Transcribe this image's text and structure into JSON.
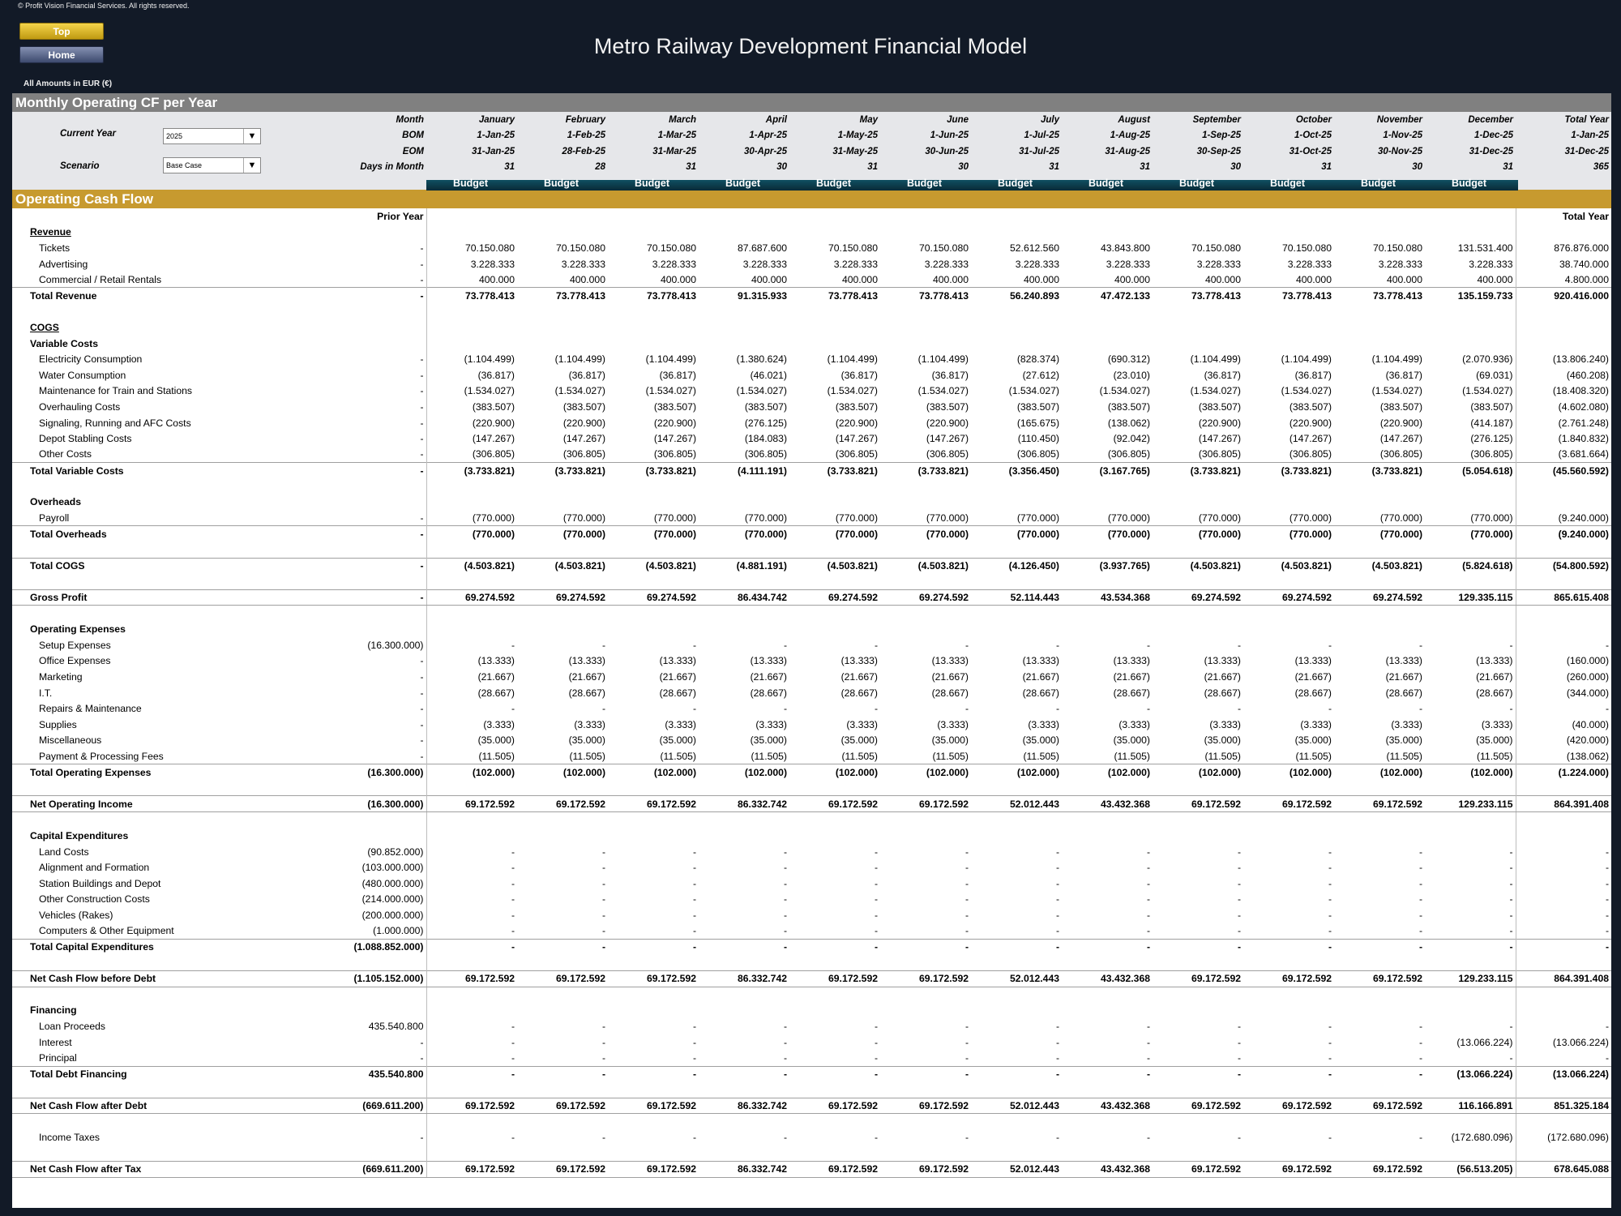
{
  "header": {
    "copyright": "© Profit Vision Financial Services. All rights reserved.",
    "top_button": "Top",
    "home_button": "Home",
    "title": "Metro Railway Development Financial Model",
    "amounts_note": "All Amounts in  EUR (€)"
  },
  "section_title": "Monthly Operating CF per Year",
  "controls": {
    "current_year_label": "Current Year",
    "current_year_value": "2025",
    "scenario_label": "Scenario",
    "scenario_value": "Base Case"
  },
  "row_labels": {
    "month": "Month",
    "bom": "BOM",
    "eom": "EOM",
    "days": "Days in Month"
  },
  "months": [
    "January",
    "February",
    "March",
    "April",
    "May",
    "June",
    "July",
    "August",
    "September",
    "October",
    "November",
    "December",
    "Total Year"
  ],
  "bom": [
    "1-Jan-25",
    "1-Feb-25",
    "1-Mar-25",
    "1-Apr-25",
    "1-May-25",
    "1-Jun-25",
    "1-Jul-25",
    "1-Aug-25",
    "1-Sep-25",
    "1-Oct-25",
    "1-Nov-25",
    "1-Dec-25",
    "1-Jan-25"
  ],
  "eom": [
    "31-Jan-25",
    "28-Feb-25",
    "31-Mar-25",
    "30-Apr-25",
    "31-May-25",
    "30-Jun-25",
    "31-Jul-25",
    "31-Aug-25",
    "30-Sep-25",
    "31-Oct-25",
    "30-Nov-25",
    "31-Dec-25",
    "31-Dec-25"
  ],
  "days": [
    "31",
    "28",
    "31",
    "30",
    "31",
    "30",
    "31",
    "31",
    "30",
    "31",
    "30",
    "31",
    "365"
  ],
  "budget_label": "Budget",
  "ocf_title": "Operating Cash Flow",
  "prior_year_header": "Prior Year",
  "total_year_header": "Total Year",
  "rows": [
    {
      "label": "Revenue",
      "style": "head-u",
      "py": "",
      "v": []
    },
    {
      "label": "Tickets",
      "style": "sub",
      "py": "-",
      "v": [
        "70.150.080",
        "70.150.080",
        "70.150.080",
        "87.687.600",
        "70.150.080",
        "70.150.080",
        "52.612.560",
        "43.843.800",
        "70.150.080",
        "70.150.080",
        "70.150.080",
        "131.531.400",
        "876.876.000"
      ]
    },
    {
      "label": "Advertising",
      "style": "sub",
      "py": "-",
      "v": [
        "3.228.333",
        "3.228.333",
        "3.228.333",
        "3.228.333",
        "3.228.333",
        "3.228.333",
        "3.228.333",
        "3.228.333",
        "3.228.333",
        "3.228.333",
        "3.228.333",
        "3.228.333",
        "38.740.000"
      ]
    },
    {
      "label": "Commercial / Retail Rentals",
      "style": "sub",
      "py": "-",
      "v": [
        "400.000",
        "400.000",
        "400.000",
        "400.000",
        "400.000",
        "400.000",
        "400.000",
        "400.000",
        "400.000",
        "400.000",
        "400.000",
        "400.000",
        "4.800.000"
      ]
    },
    {
      "label": "Total Revenue",
      "style": "total",
      "py": "-",
      "v": [
        "73.778.413",
        "73.778.413",
        "73.778.413",
        "91.315.933",
        "73.778.413",
        "73.778.413",
        "56.240.893",
        "47.472.133",
        "73.778.413",
        "73.778.413",
        "73.778.413",
        "135.159.733",
        "920.416.000"
      ]
    },
    {
      "label": "",
      "style": "blank",
      "py": "",
      "v": []
    },
    {
      "label": "COGS",
      "style": "head-u",
      "py": "",
      "v": []
    },
    {
      "label": "Variable Costs",
      "style": "head",
      "py": "",
      "v": []
    },
    {
      "label": "Electricity Consumption",
      "style": "sub",
      "py": "-",
      "v": [
        "(1.104.499)",
        "(1.104.499)",
        "(1.104.499)",
        "(1.380.624)",
        "(1.104.499)",
        "(1.104.499)",
        "(828.374)",
        "(690.312)",
        "(1.104.499)",
        "(1.104.499)",
        "(1.104.499)",
        "(2.070.936)",
        "(13.806.240)"
      ]
    },
    {
      "label": "Water Consumption",
      "style": "sub",
      "py": "-",
      "v": [
        "(36.817)",
        "(36.817)",
        "(36.817)",
        "(46.021)",
        "(36.817)",
        "(36.817)",
        "(27.612)",
        "(23.010)",
        "(36.817)",
        "(36.817)",
        "(36.817)",
        "(69.031)",
        "(460.208)"
      ]
    },
    {
      "label": "Maintenance for Train and Stations",
      "style": "sub",
      "py": "-",
      "v": [
        "(1.534.027)",
        "(1.534.027)",
        "(1.534.027)",
        "(1.534.027)",
        "(1.534.027)",
        "(1.534.027)",
        "(1.534.027)",
        "(1.534.027)",
        "(1.534.027)",
        "(1.534.027)",
        "(1.534.027)",
        "(1.534.027)",
        "(18.408.320)"
      ]
    },
    {
      "label": "Overhauling Costs",
      "style": "sub",
      "py": "-",
      "v": [
        "(383.507)",
        "(383.507)",
        "(383.507)",
        "(383.507)",
        "(383.507)",
        "(383.507)",
        "(383.507)",
        "(383.507)",
        "(383.507)",
        "(383.507)",
        "(383.507)",
        "(383.507)",
        "(4.602.080)"
      ]
    },
    {
      "label": "Signaling, Running and AFC Costs",
      "style": "sub",
      "py": "-",
      "v": [
        "(220.900)",
        "(220.900)",
        "(220.900)",
        "(276.125)",
        "(220.900)",
        "(220.900)",
        "(165.675)",
        "(138.062)",
        "(220.900)",
        "(220.900)",
        "(220.900)",
        "(414.187)",
        "(2.761.248)"
      ]
    },
    {
      "label": "Depot Stabling Costs",
      "style": "sub",
      "py": "-",
      "v": [
        "(147.267)",
        "(147.267)",
        "(147.267)",
        "(184.083)",
        "(147.267)",
        "(147.267)",
        "(110.450)",
        "(92.042)",
        "(147.267)",
        "(147.267)",
        "(147.267)",
        "(276.125)",
        "(1.840.832)"
      ]
    },
    {
      "label": "Other Costs",
      "style": "sub",
      "py": "-",
      "v": [
        "(306.805)",
        "(306.805)",
        "(306.805)",
        "(306.805)",
        "(306.805)",
        "(306.805)",
        "(306.805)",
        "(306.805)",
        "(306.805)",
        "(306.805)",
        "(306.805)",
        "(306.805)",
        "(3.681.664)"
      ]
    },
    {
      "label": "Total Variable Costs",
      "style": "total",
      "py": "-",
      "v": [
        "(3.733.821)",
        "(3.733.821)",
        "(3.733.821)",
        "(4.111.191)",
        "(3.733.821)",
        "(3.733.821)",
        "(3.356.450)",
        "(3.167.765)",
        "(3.733.821)",
        "(3.733.821)",
        "(3.733.821)",
        "(5.054.618)",
        "(45.560.592)"
      ]
    },
    {
      "label": "",
      "style": "blank",
      "py": "",
      "v": []
    },
    {
      "label": "Overheads",
      "style": "head",
      "py": "",
      "v": []
    },
    {
      "label": "Payroll",
      "style": "sub",
      "py": "-",
      "v": [
        "(770.000)",
        "(770.000)",
        "(770.000)",
        "(770.000)",
        "(770.000)",
        "(770.000)",
        "(770.000)",
        "(770.000)",
        "(770.000)",
        "(770.000)",
        "(770.000)",
        "(770.000)",
        "(9.240.000)"
      ]
    },
    {
      "label": "Total Overheads",
      "style": "total",
      "py": "-",
      "v": [
        "(770.000)",
        "(770.000)",
        "(770.000)",
        "(770.000)",
        "(770.000)",
        "(770.000)",
        "(770.000)",
        "(770.000)",
        "(770.000)",
        "(770.000)",
        "(770.000)",
        "(770.000)",
        "(9.240.000)"
      ]
    },
    {
      "label": "",
      "style": "blank",
      "py": "",
      "v": []
    },
    {
      "label": "Total COGS",
      "style": "total",
      "py": "-",
      "v": [
        "(4.503.821)",
        "(4.503.821)",
        "(4.503.821)",
        "(4.881.191)",
        "(4.503.821)",
        "(4.503.821)",
        "(4.126.450)",
        "(3.937.765)",
        "(4.503.821)",
        "(4.503.821)",
        "(4.503.821)",
        "(5.824.618)",
        "(54.800.592)"
      ]
    },
    {
      "label": "",
      "style": "blank",
      "py": "",
      "v": []
    },
    {
      "label": "Gross Profit",
      "style": "grand",
      "py": "-",
      "v": [
        "69.274.592",
        "69.274.592",
        "69.274.592",
        "86.434.742",
        "69.274.592",
        "69.274.592",
        "52.114.443",
        "43.534.368",
        "69.274.592",
        "69.274.592",
        "69.274.592",
        "129.335.115",
        "865.615.408"
      ]
    },
    {
      "label": "",
      "style": "blank",
      "py": "",
      "v": []
    },
    {
      "label": "Operating Expenses",
      "style": "head",
      "py": "",
      "v": []
    },
    {
      "label": "Setup Expenses",
      "style": "sub",
      "py": "(16.300.000)",
      "v": [
        "-",
        "-",
        "-",
        "-",
        "-",
        "-",
        "-",
        "-",
        "-",
        "-",
        "-",
        "-",
        "-"
      ]
    },
    {
      "label": "Office Expenses",
      "style": "sub",
      "py": "-",
      "v": [
        "(13.333)",
        "(13.333)",
        "(13.333)",
        "(13.333)",
        "(13.333)",
        "(13.333)",
        "(13.333)",
        "(13.333)",
        "(13.333)",
        "(13.333)",
        "(13.333)",
        "(13.333)",
        "(160.000)"
      ]
    },
    {
      "label": "Marketing",
      "style": "sub",
      "py": "-",
      "v": [
        "(21.667)",
        "(21.667)",
        "(21.667)",
        "(21.667)",
        "(21.667)",
        "(21.667)",
        "(21.667)",
        "(21.667)",
        "(21.667)",
        "(21.667)",
        "(21.667)",
        "(21.667)",
        "(260.000)"
      ]
    },
    {
      "label": "I.T.",
      "style": "sub",
      "py": "-",
      "v": [
        "(28.667)",
        "(28.667)",
        "(28.667)",
        "(28.667)",
        "(28.667)",
        "(28.667)",
        "(28.667)",
        "(28.667)",
        "(28.667)",
        "(28.667)",
        "(28.667)",
        "(28.667)",
        "(344.000)"
      ]
    },
    {
      "label": "Repairs & Maintenance",
      "style": "sub",
      "py": "-",
      "v": [
        "-",
        "-",
        "-",
        "-",
        "-",
        "-",
        "-",
        "-",
        "-",
        "-",
        "-",
        "-",
        "-"
      ]
    },
    {
      "label": "Supplies",
      "style": "sub",
      "py": "-",
      "v": [
        "(3.333)",
        "(3.333)",
        "(3.333)",
        "(3.333)",
        "(3.333)",
        "(3.333)",
        "(3.333)",
        "(3.333)",
        "(3.333)",
        "(3.333)",
        "(3.333)",
        "(3.333)",
        "(40.000)"
      ]
    },
    {
      "label": "Miscellaneous",
      "style": "sub",
      "py": "-",
      "v": [
        "(35.000)",
        "(35.000)",
        "(35.000)",
        "(35.000)",
        "(35.000)",
        "(35.000)",
        "(35.000)",
        "(35.000)",
        "(35.000)",
        "(35.000)",
        "(35.000)",
        "(35.000)",
        "(420.000)"
      ]
    },
    {
      "label": "Payment & Processing Fees",
      "style": "sub",
      "py": "-",
      "v": [
        "(11.505)",
        "(11.505)",
        "(11.505)",
        "(11.505)",
        "(11.505)",
        "(11.505)",
        "(11.505)",
        "(11.505)",
        "(11.505)",
        "(11.505)",
        "(11.505)",
        "(11.505)",
        "(138.062)"
      ]
    },
    {
      "label": "Total Operating Expenses",
      "style": "total",
      "py": "(16.300.000)",
      "v": [
        "(102.000)",
        "(102.000)",
        "(102.000)",
        "(102.000)",
        "(102.000)",
        "(102.000)",
        "(102.000)",
        "(102.000)",
        "(102.000)",
        "(102.000)",
        "(102.000)",
        "(102.000)",
        "(1.224.000)"
      ]
    },
    {
      "label": "",
      "style": "blank",
      "py": "",
      "v": []
    },
    {
      "label": "Net Operating Income",
      "style": "grand",
      "py": "(16.300.000)",
      "v": [
        "69.172.592",
        "69.172.592",
        "69.172.592",
        "86.332.742",
        "69.172.592",
        "69.172.592",
        "52.012.443",
        "43.432.368",
        "69.172.592",
        "69.172.592",
        "69.172.592",
        "129.233.115",
        "864.391.408"
      ]
    },
    {
      "label": "",
      "style": "blank",
      "py": "",
      "v": []
    },
    {
      "label": "Capital Expenditures",
      "style": "head",
      "py": "",
      "v": []
    },
    {
      "label": "Land Costs",
      "style": "sub",
      "py": "(90.852.000)",
      "v": [
        "-",
        "-",
        "-",
        "-",
        "-",
        "-",
        "-",
        "-",
        "-",
        "-",
        "-",
        "-",
        "-"
      ]
    },
    {
      "label": "Alignment and Formation",
      "style": "sub",
      "py": "(103.000.000)",
      "v": [
        "-",
        "-",
        "-",
        "-",
        "-",
        "-",
        "-",
        "-",
        "-",
        "-",
        "-",
        "-",
        "-"
      ]
    },
    {
      "label": "Station Buildings and Depot",
      "style": "sub",
      "py": "(480.000.000)",
      "v": [
        "-",
        "-",
        "-",
        "-",
        "-",
        "-",
        "-",
        "-",
        "-",
        "-",
        "-",
        "-",
        "-"
      ]
    },
    {
      "label": "Other Construction Costs",
      "style": "sub",
      "py": "(214.000.000)",
      "v": [
        "-",
        "-",
        "-",
        "-",
        "-",
        "-",
        "-",
        "-",
        "-",
        "-",
        "-",
        "-",
        "-"
      ]
    },
    {
      "label": "Vehicles (Rakes)",
      "style": "sub",
      "py": "(200.000.000)",
      "v": [
        "-",
        "-",
        "-",
        "-",
        "-",
        "-",
        "-",
        "-",
        "-",
        "-",
        "-",
        "-",
        "-"
      ]
    },
    {
      "label": "Computers & Other Equipment",
      "style": "sub",
      "py": "(1.000.000)",
      "v": [
        "-",
        "-",
        "-",
        "-",
        "-",
        "-",
        "-",
        "-",
        "-",
        "-",
        "-",
        "-",
        "-"
      ]
    },
    {
      "label": "Total Capital Expenditures",
      "style": "total",
      "py": "(1.088.852.000)",
      "v": [
        "-",
        "-",
        "-",
        "-",
        "-",
        "-",
        "-",
        "-",
        "-",
        "-",
        "-",
        "-",
        "-"
      ]
    },
    {
      "label": "",
      "style": "blank",
      "py": "",
      "v": []
    },
    {
      "label": "Net Cash Flow before Debt",
      "style": "grand",
      "py": "(1.105.152.000)",
      "v": [
        "69.172.592",
        "69.172.592",
        "69.172.592",
        "86.332.742",
        "69.172.592",
        "69.172.592",
        "52.012.443",
        "43.432.368",
        "69.172.592",
        "69.172.592",
        "69.172.592",
        "129.233.115",
        "864.391.408"
      ]
    },
    {
      "label": "",
      "style": "blank",
      "py": "",
      "v": []
    },
    {
      "label": "Financing",
      "style": "head",
      "py": "",
      "v": []
    },
    {
      "label": "Loan Proceeds",
      "style": "sub",
      "py": "435.540.800",
      "v": [
        "-",
        "-",
        "-",
        "-",
        "-",
        "-",
        "-",
        "-",
        "-",
        "-",
        "-",
        "-",
        "-"
      ]
    },
    {
      "label": "Interest",
      "style": "sub",
      "py": "-",
      "v": [
        "-",
        "-",
        "-",
        "-",
        "-",
        "-",
        "-",
        "-",
        "-",
        "-",
        "-",
        "(13.066.224)",
        "(13.066.224)"
      ]
    },
    {
      "label": "Principal",
      "style": "sub",
      "py": "-",
      "v": [
        "-",
        "-",
        "-",
        "-",
        "-",
        "-",
        "-",
        "-",
        "-",
        "-",
        "-",
        "-",
        "-"
      ]
    },
    {
      "label": "Total Debt Financing",
      "style": "total",
      "py": "435.540.800",
      "v": [
        "-",
        "-",
        "-",
        "-",
        "-",
        "-",
        "-",
        "-",
        "-",
        "-",
        "-",
        "(13.066.224)",
        "(13.066.224)"
      ]
    },
    {
      "label": "",
      "style": "blank",
      "py": "",
      "v": []
    },
    {
      "label": "Net Cash Flow after Debt",
      "style": "grand",
      "py": "(669.611.200)",
      "v": [
        "69.172.592",
        "69.172.592",
        "69.172.592",
        "86.332.742",
        "69.172.592",
        "69.172.592",
        "52.012.443",
        "43.432.368",
        "69.172.592",
        "69.172.592",
        "69.172.592",
        "116.166.891",
        "851.325.184"
      ]
    },
    {
      "label": "",
      "style": "blank",
      "py": "",
      "v": []
    },
    {
      "label": "Income Taxes",
      "style": "sub",
      "py": "-",
      "v": [
        "-",
        "-",
        "-",
        "-",
        "-",
        "-",
        "-",
        "-",
        "-",
        "-",
        "-",
        "(172.680.096)",
        "(172.680.096)"
      ]
    },
    {
      "label": "",
      "style": "blank",
      "py": "",
      "v": []
    },
    {
      "label": "Net Cash Flow after Tax",
      "style": "grand",
      "py": "(669.611.200)",
      "v": [
        "69.172.592",
        "69.172.592",
        "69.172.592",
        "86.332.742",
        "69.172.592",
        "69.172.592",
        "52.012.443",
        "43.432.368",
        "69.172.592",
        "69.172.592",
        "69.172.592",
        "(56.513.205)",
        "678.645.088"
      ]
    }
  ]
}
